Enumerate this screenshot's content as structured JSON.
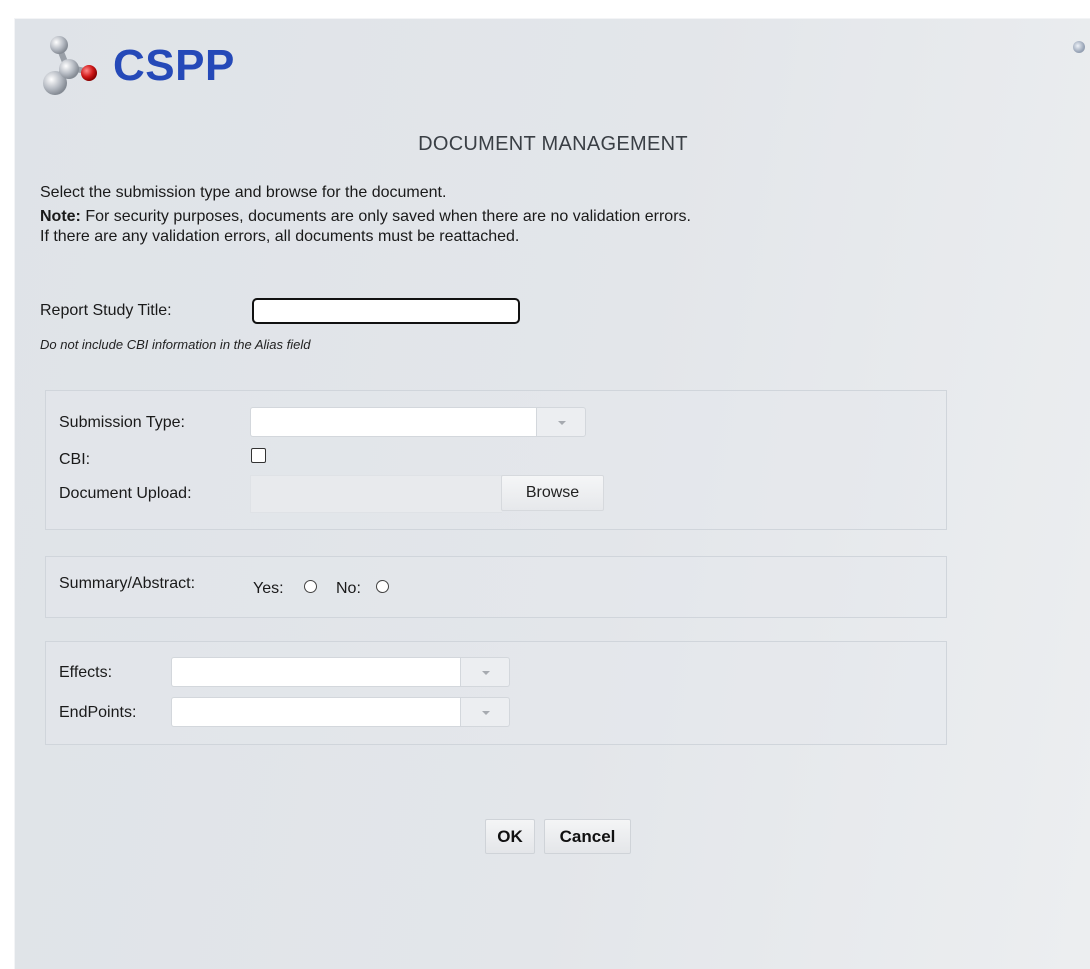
{
  "app": {
    "logo_text": "CSPP",
    "page_title": "DOCUMENT MANAGEMENT"
  },
  "instructions": {
    "line1": "Select the submission type and browse for the document.",
    "note_label": "Note:",
    "note_text": " For security purposes, documents are only saved when there are no validation errors.",
    "line3": "If there are any validation errors, all documents must be reattached."
  },
  "report": {
    "title_label": "Report Study Title:",
    "title_value": "",
    "alias_hint": "Do not include CBI information in the Alias field"
  },
  "submission": {
    "type_label": "Submission Type:",
    "type_value": "",
    "cbi_label": "CBI:",
    "cbi_checked": false,
    "upload_label": "Document Upload:",
    "browse_label": "Browse"
  },
  "summary": {
    "label": "Summary/Abstract:",
    "yes_label": "Yes:",
    "no_label": "No:"
  },
  "effects": {
    "effects_label": "Effects:",
    "effects_value": "",
    "endpoints_label": "EndPoints:",
    "endpoints_value": ""
  },
  "actions": {
    "ok_label": "OK",
    "cancel_label": "Cancel"
  },
  "colors": {
    "logo_blue": "#2549b8",
    "panel_bg": "#e3e6ea"
  },
  "icons": {
    "logo": "molecule-icon",
    "corner": "help-icon"
  }
}
